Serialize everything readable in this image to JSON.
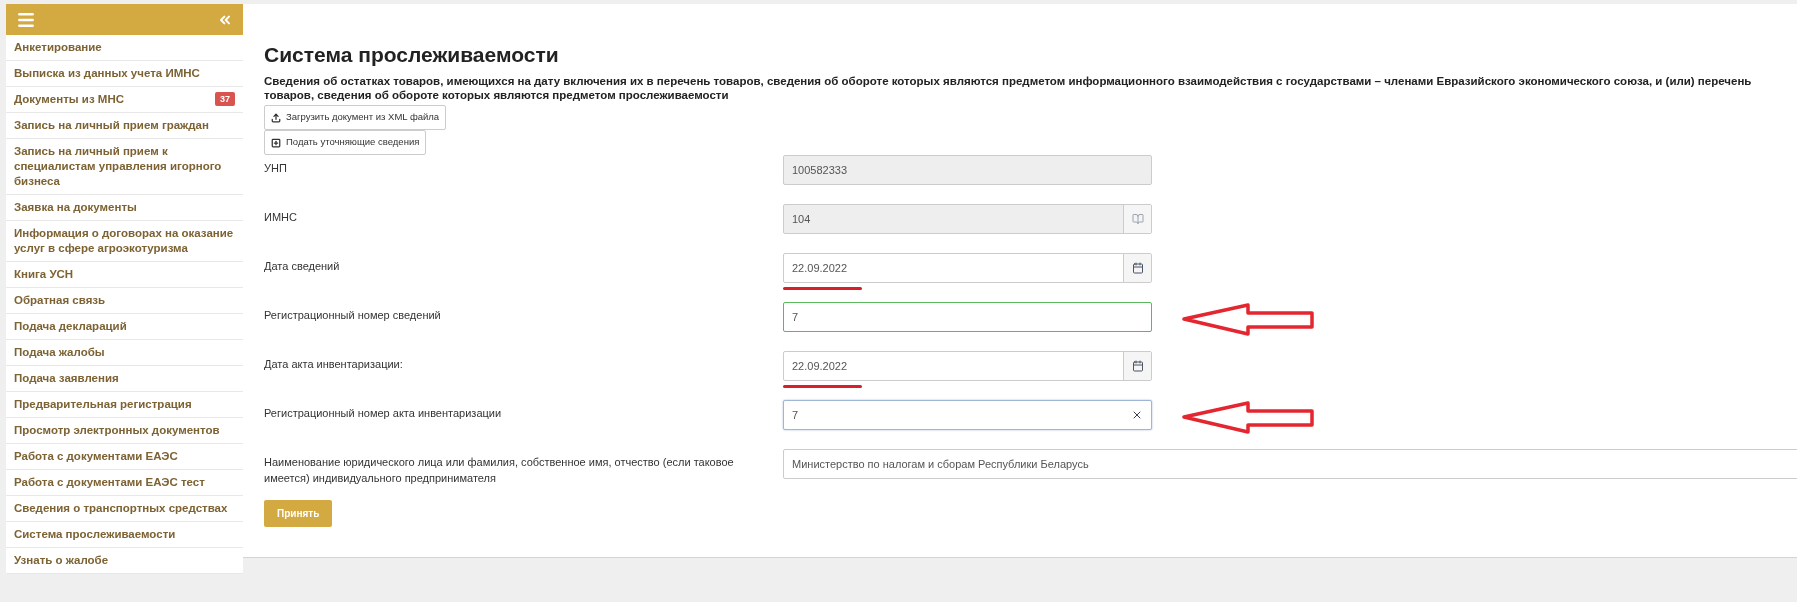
{
  "sidebar": {
    "items": [
      {
        "label": "Анкетирование",
        "selected": false
      },
      {
        "label": "Выписка из данных учета ИМНС",
        "selected": false
      },
      {
        "label": "Документы из МНС",
        "badge": "37",
        "selected": false
      },
      {
        "label": "Запись на личный прием граждан",
        "selected": false
      },
      {
        "label": "Запись на личный прием к специалистам управления игорного бизнеса",
        "selected": false
      },
      {
        "label": "Заявка на документы",
        "selected": false
      },
      {
        "label": "Информация о договорах на оказание услуг в сфере агроэкотуризма",
        "selected": false
      },
      {
        "label": "Книга УСН",
        "selected": false
      },
      {
        "label": "Обратная связь",
        "selected": false
      },
      {
        "label": "Подача деклараций",
        "selected": false
      },
      {
        "label": "Подача жалобы",
        "selected": false
      },
      {
        "label": "Подача заявления",
        "selected": false
      },
      {
        "label": "Предварительная регистрация",
        "selected": false
      },
      {
        "label": "Просмотр электронных документов",
        "selected": false
      },
      {
        "label": "Работа с документами ЕАЭС",
        "selected": false
      },
      {
        "label": "Работа с документами ЕАЭС тест",
        "selected": false
      },
      {
        "label": "Сведения о транспортных средствах",
        "selected": false
      },
      {
        "label": "Система прослеживаемости",
        "selected": false
      },
      {
        "label": "Узнать о жалобе",
        "selected": false
      }
    ]
  },
  "page": {
    "title": "Система прослеживаемости",
    "subtitle": "Сведения об остатках товаров, имеющихся на дату включения их в перечень товаров, сведения об обороте которых являются предметом информационного взаимодействия с государствами – членами Евразийского экономического союза, и (или) перечень товаров, сведения об обороте которых являются предметом прослеживаемости",
    "actions": [
      {
        "label": "Загрузить документ из XML файла",
        "kind": "upload"
      },
      {
        "label": "Подать уточняющие сведения",
        "kind": "add"
      }
    ],
    "fields": [
      {
        "label": "УНП",
        "value": "100582333",
        "kind": "readonly",
        "valid": false,
        "focused": false,
        "underlined": false,
        "arrow": false
      },
      {
        "label": "ИМНС",
        "value": "104",
        "kind": "lookup",
        "valid": false,
        "focused": false,
        "underlined": false,
        "arrow": false
      },
      {
        "label": "Дата сведений",
        "value": "22.09.2022",
        "kind": "date",
        "valid": false,
        "focused": false,
        "underlined": true,
        "arrow": false
      },
      {
        "label": "Регистрационный номер сведений",
        "value": "7",
        "kind": "text",
        "valid": true,
        "focused": false,
        "underlined": false,
        "arrow": true
      },
      {
        "label": "Дата акта инвентаризации:",
        "value": "22.09.2022",
        "kind": "date",
        "valid": false,
        "focused": false,
        "underlined": true,
        "arrow": false
      },
      {
        "label": "Регистрационный номер акта инвентаризации",
        "value": "7",
        "kind": "clearable",
        "valid": false,
        "focused": true,
        "underlined": false,
        "arrow": true
      },
      {
        "label": "Наименование юридического лица или фамилия, собственное имя, отчество (если таковое имеется) индивидуального предпринимателя",
        "value": "Министерство по налогам и сборам Республики Беларусь",
        "kind": "wide",
        "valid": false,
        "focused": false,
        "underlined": false,
        "arrow": false
      }
    ],
    "submit": "Принять"
  }
}
